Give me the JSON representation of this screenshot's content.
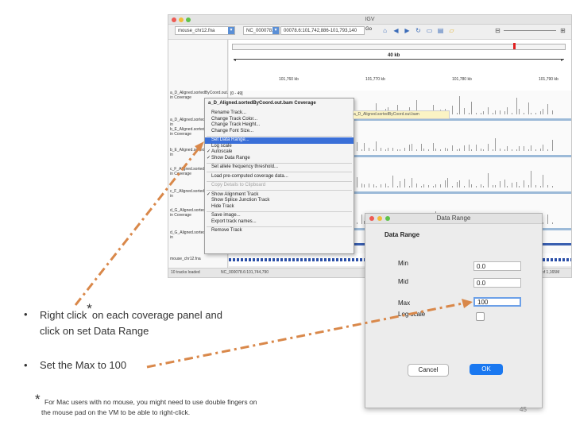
{
  "igv": {
    "title": "IGV",
    "genome": "mouse_chr12.fna",
    "chromosome": "NC_000078.6",
    "locus": "00078.6:101,742,886-101,793,140",
    "go_label": "Go",
    "scale": "40 kb",
    "ruler_ticks": [
      "101,760 kb",
      "101,770 kb",
      "101,780 kb",
      "101,790 kb"
    ],
    "range_label": "[0 - 49]",
    "tracks": [
      {
        "name": "a_D_Aligned.sortedByCoord.out.",
        "sub": "in Coverage"
      },
      {
        "name": "a_D_Aligned.sortedByCoord.out.",
        "sub": "in"
      },
      {
        "name": "b_E_Aligned.sortedByCoord.out.",
        "sub": "in Coverage"
      },
      {
        "name": "b_E_Aligned.sortedByCoord.out.",
        "sub": "in"
      },
      {
        "name": "c_F_Aligned.sortedByCoord.out.",
        "sub": "in Coverage"
      },
      {
        "name": "c_F_Aligned.sortedByCoord.out.",
        "sub": "in"
      },
      {
        "name": "d_G_Aligned.sortedByCoord.out.",
        "sub": "in Coverage"
      },
      {
        "name": "d_G_Aligned.sortedByCoord.out.",
        "sub": "in"
      }
    ],
    "sequence_track": "mouse_chr12.fna",
    "status_left": "10 tracks loaded",
    "status_locus": "NC_000078.6:101,744,790",
    "status_right": "of 1,165M"
  },
  "context_menu": {
    "title": "a_D_Aligned.sortedByCoord.out.bam Coverage",
    "items": [
      {
        "label": "Rename Track...",
        "state": "normal"
      },
      {
        "label": "Change Track Color...",
        "state": "normal"
      },
      {
        "label": "Change Track Height...",
        "state": "normal"
      },
      {
        "label": "Change Font Size...",
        "state": "normal"
      },
      {
        "label": "Set Data Range...",
        "state": "selected"
      },
      {
        "label": "Log scale",
        "state": "normal"
      },
      {
        "label": "Autoscale",
        "state": "checked"
      },
      {
        "label": "Show Data Range",
        "state": "checked"
      },
      {
        "label": "Set allele frequency threshold...",
        "state": "normal"
      },
      {
        "label": "Load pre-computed coverage data...",
        "state": "normal"
      },
      {
        "label": "Copy Details to Clipboard",
        "state": "disabled"
      },
      {
        "label": "Show Alignment Track",
        "state": "checked"
      },
      {
        "label": "Show Splice Junction Track",
        "state": "normal"
      },
      {
        "label": "Hide Track",
        "state": "normal"
      },
      {
        "label": "Save image...",
        "state": "normal"
      },
      {
        "label": "Export track names...",
        "state": "normal"
      },
      {
        "label": "Remove Track",
        "state": "normal"
      }
    ],
    "tooltip": "a_D_Aligned.sortedByCoord.out.bam"
  },
  "dialog": {
    "title": "Data Range",
    "heading": "Data Range",
    "min_label": "Min",
    "min_value": "0.0",
    "mid_label": "Mid",
    "mid_value": "0.0",
    "max_label": "Max",
    "max_value": "100",
    "log_label": "Log scale",
    "cancel_label": "Cancel",
    "ok_label": "OK",
    "accent": "#1a78f0"
  },
  "slide": {
    "bullet1_line1": "Right click",
    "bullet1_star": "*",
    "bullet1_line1b": "on each coverage panel and",
    "bullet1_line2": "click on set Data Range",
    "bullet2": "Set the Max to 100",
    "bullet_symbol": "•",
    "footnote_star": "*",
    "footnote_line1": "For Mac users with no mouse, you might need to use double fingers on",
    "footnote_line2": "the mouse pad on the VM to be able to right-click.",
    "page_number": "45",
    "arrow_color": "#d9884a"
  }
}
